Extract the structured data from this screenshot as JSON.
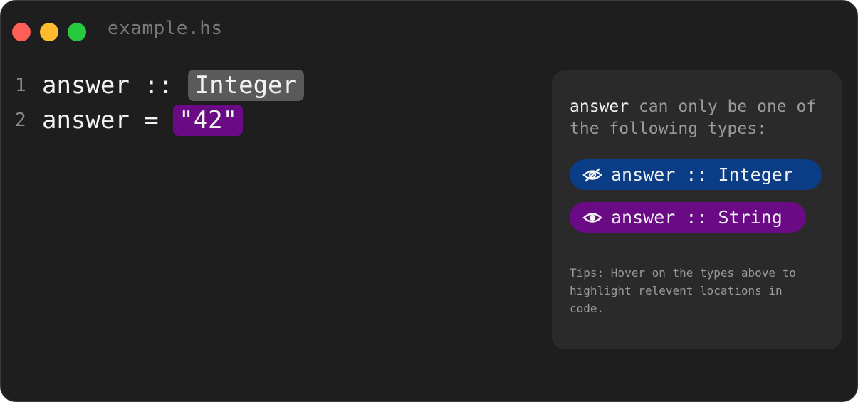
{
  "window": {
    "title": "example.hs",
    "traffic_lights": [
      "close",
      "minimize",
      "maximize"
    ]
  },
  "editor": {
    "lines": [
      {
        "number": "1",
        "before": "answer :: ",
        "highlight": "Integer",
        "after": ""
      },
      {
        "number": "2",
        "before": "answer = ",
        "highlight": "\"42\"",
        "after": ""
      }
    ]
  },
  "panel": {
    "ident": "answer",
    "message": " can only be one of the following types:",
    "options": [
      {
        "icon": "eye-slash-icon",
        "label": "answer :: Integer",
        "color": "#0b3d86"
      },
      {
        "icon": "eye-icon",
        "label": "answer :: String",
        "color": "#6a0a84"
      }
    ],
    "tips": "Tips: Hover on the types above to highlight relevent locations in code."
  },
  "colors": {
    "background": "#1e1e1e",
    "panel": "#2a2a2a",
    "highlight_gray": "#5a5a5a",
    "highlight_purple": "#6a0a84",
    "highlight_blue": "#0b3d86"
  }
}
